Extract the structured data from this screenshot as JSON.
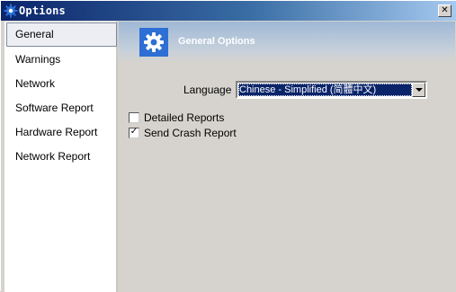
{
  "window": {
    "title": "Options",
    "close_glyph": "✕"
  },
  "sidebar": {
    "items": [
      {
        "label": "General",
        "selected": true
      },
      {
        "label": "Warnings",
        "selected": false
      },
      {
        "label": "Network",
        "selected": false
      },
      {
        "label": "Software Report",
        "selected": false
      },
      {
        "label": "Hardware Report",
        "selected": false
      },
      {
        "label": "Network Report",
        "selected": false
      }
    ]
  },
  "main": {
    "header_title": "General Options",
    "header_icon": "gear-icon",
    "language": {
      "label": "Language",
      "selected_value": "Chinese - Simplified (简體中文)"
    },
    "options": [
      {
        "label": "Detailed Reports",
        "checked": false,
        "mark": ""
      },
      {
        "label": "Send Crash Report",
        "checked": true,
        "mark": "✓"
      }
    ]
  },
  "colors": {
    "accent": "#2d6fd4",
    "titlebar_start": "#0b246a",
    "selection": "#0a246a",
    "background": "#d6d3ce"
  }
}
